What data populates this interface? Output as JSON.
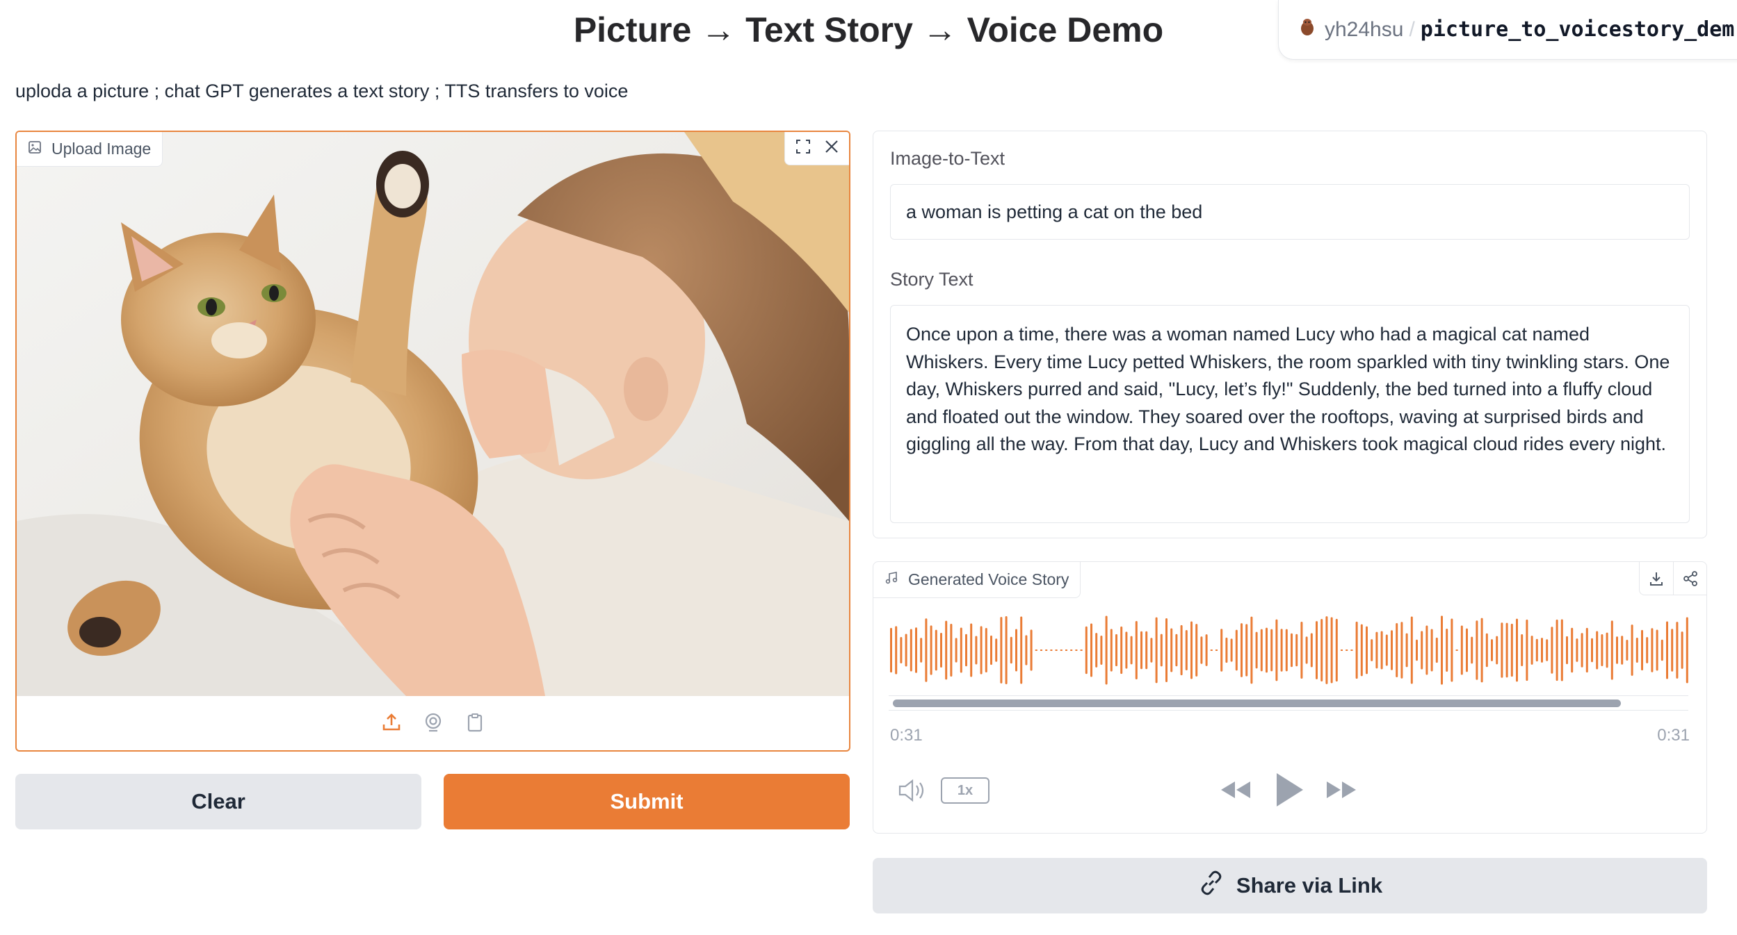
{
  "header": {
    "title": "Picture → Text Story → Voice Demo",
    "space_owner": "yh24hsu",
    "space_separator": "/",
    "space_repo": "picture_to_voicestory_dem"
  },
  "description": "uploda a picture ; chat GPT generates a text story ; TTS transfers to voice",
  "image_input": {
    "label": "Upload Image"
  },
  "buttons": {
    "clear": "Clear",
    "submit": "Submit"
  },
  "image_to_text": {
    "label": "Image-to-Text",
    "value": "a woman is petting a cat on the bed"
  },
  "story_text": {
    "label": "Story Text",
    "value": "Once upon a time, there was a woman named Lucy who had a magical cat named Whiskers. Every time Lucy petted Whiskers, the room sparkled with tiny twinkling stars. One day, Whiskers purred and said, \"Lucy, let’s fly!\" Suddenly, the bed turned into a fluffy cloud and floated out the window. They soared over the rooftops, waving at surprised birds and giggling all the way. From that day, Lucy and Whiskers took magical cloud rides every night."
  },
  "audio": {
    "label": "Generated Voice Story",
    "current_time": "0:31",
    "duration": "0:31",
    "speed": "1x",
    "progress": 0.92,
    "waveform_color": "#ea7c35"
  },
  "share": {
    "label": "Share via Link"
  },
  "colors": {
    "accent": "#ea7c35",
    "border": "#e5e7eb",
    "button_secondary": "#e5e7eb"
  }
}
